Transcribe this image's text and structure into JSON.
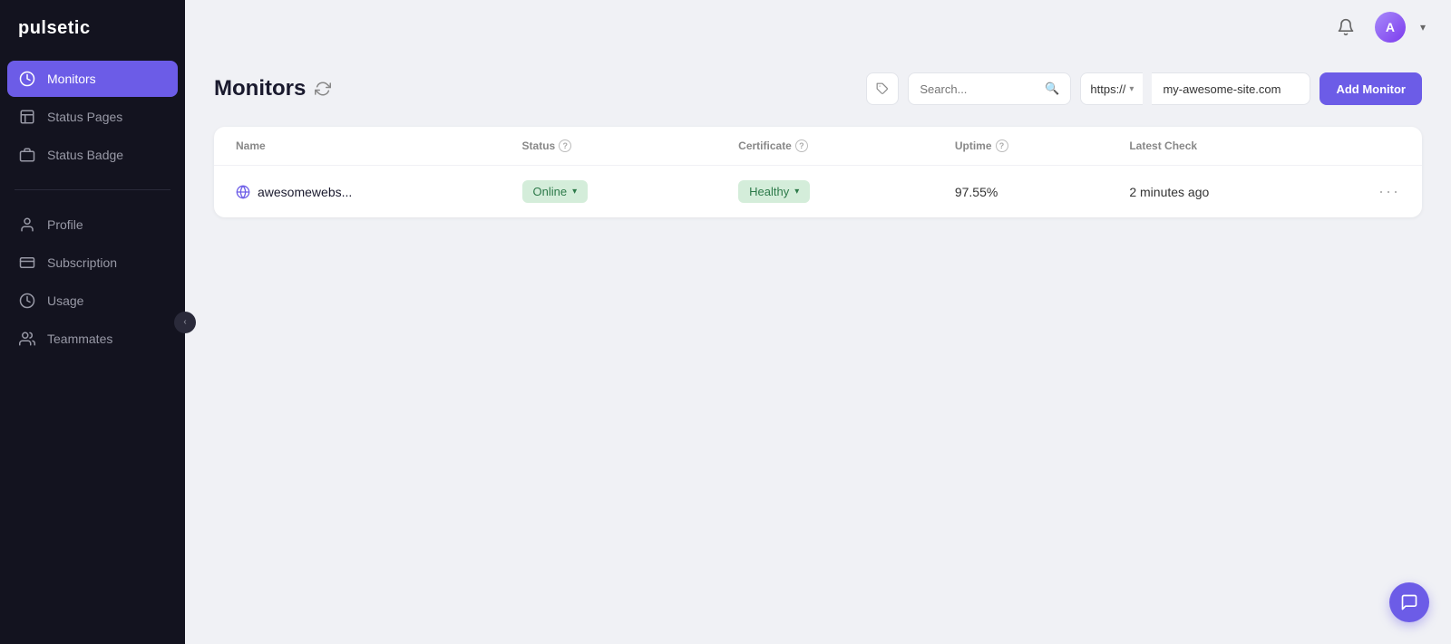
{
  "app": {
    "logo": "pulsetic"
  },
  "sidebar": {
    "items": [
      {
        "id": "monitors",
        "label": "Monitors",
        "active": true,
        "icon": "monitor"
      },
      {
        "id": "status-pages",
        "label": "Status Pages",
        "active": false,
        "icon": "status-pages"
      },
      {
        "id": "status-badge",
        "label": "Status Badge",
        "active": false,
        "icon": "badge"
      }
    ],
    "secondary_items": [
      {
        "id": "profile",
        "label": "Profile",
        "icon": "profile"
      },
      {
        "id": "subscription",
        "label": "Subscription",
        "icon": "subscription"
      },
      {
        "id": "usage",
        "label": "Usage",
        "icon": "usage"
      },
      {
        "id": "teammates",
        "label": "Teammates",
        "icon": "teammates"
      }
    ]
  },
  "topbar": {
    "avatar_initials": "A",
    "chevron": "▾"
  },
  "monitors_page": {
    "title": "Monitors",
    "add_button_label": "Add Monitor",
    "search_placeholder": "Search...",
    "url_protocol": "https://",
    "url_input_value": "my-awesome-site.com",
    "table": {
      "columns": [
        "Name",
        "Status",
        "Certificate",
        "Uptime",
        "Latest Check"
      ],
      "rows": [
        {
          "name": "awesomewebs...",
          "status": "Online",
          "certificate": "Healthy",
          "uptime": "97.55%",
          "latest_check": "2 minutes ago"
        }
      ]
    }
  }
}
